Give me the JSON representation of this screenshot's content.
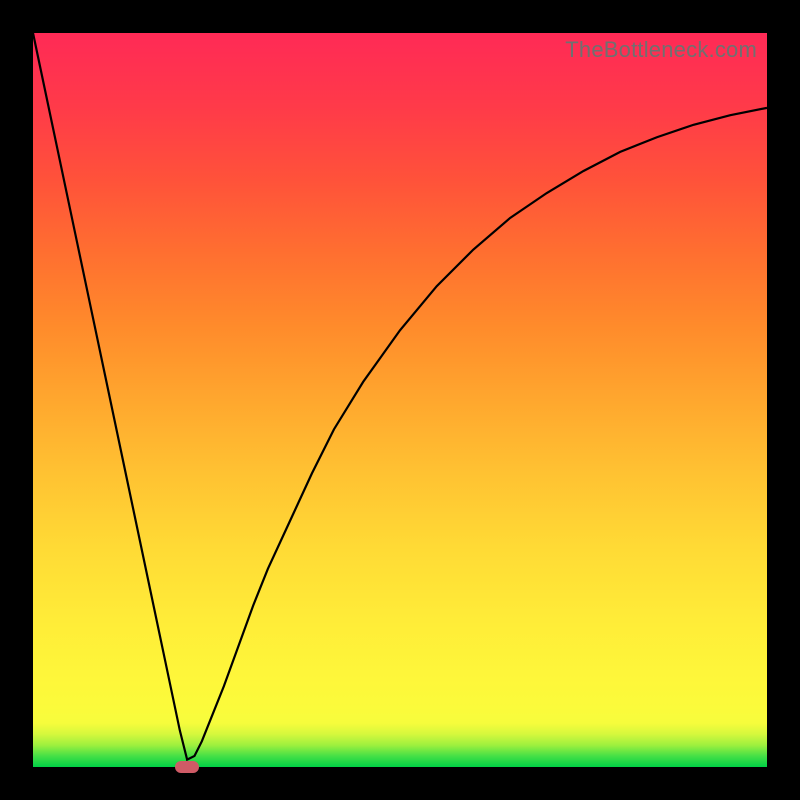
{
  "watermark": "TheBottleneck.com",
  "colors": {
    "curve_stroke": "#000000",
    "marker_fill": "#cf5b66",
    "frame_bg": "#000000"
  },
  "chart_data": {
    "type": "line",
    "title": "",
    "xlabel": "",
    "ylabel": "",
    "xlim": [
      0,
      100
    ],
    "ylim": [
      0,
      100
    ],
    "x": [
      0,
      2,
      4,
      6,
      8,
      10,
      12,
      14,
      16,
      18,
      20,
      21,
      22,
      23,
      24,
      26,
      28,
      30,
      32,
      35,
      38,
      41,
      45,
      50,
      55,
      60,
      65,
      70,
      75,
      80,
      85,
      90,
      95,
      100
    ],
    "y": [
      100,
      90.5,
      81,
      71.5,
      62,
      52.5,
      43,
      33.5,
      24,
      14.5,
      5,
      1,
      1.5,
      3.5,
      6,
      11,
      16.5,
      22,
      27,
      33.5,
      40,
      46,
      52.5,
      59.5,
      65.5,
      70.5,
      74.8,
      78.2,
      81.2,
      83.8,
      85.8,
      87.5,
      88.8,
      89.8
    ],
    "marker": {
      "x": 21,
      "y": 0
    },
    "annotations": []
  }
}
